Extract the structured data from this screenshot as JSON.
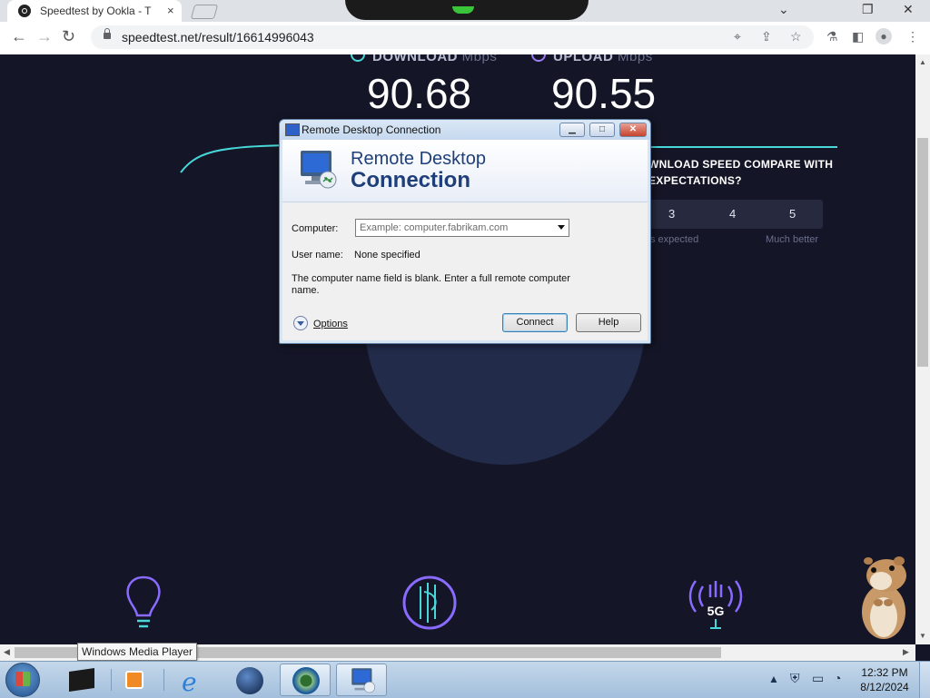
{
  "browser": {
    "tab_title": "Speedtest by Ookla - T",
    "tab_close": "×",
    "url": "speedtest.net/result/16614996043",
    "window_controls": {
      "minimize": "⌄",
      "restore": "❐",
      "close": "✕"
    },
    "nav": {
      "back": "←",
      "forward": "→",
      "reload": "↻"
    },
    "toolbar_icons": [
      "location-icon",
      "share-icon",
      "star-icon",
      "extension-icon",
      "sidepanel-icon",
      "profile-icon",
      "menu-icon"
    ]
  },
  "speedtest": {
    "download": {
      "label": "DOWNLOAD",
      "unit": "Mbps",
      "value": "90.68"
    },
    "upload": {
      "label": "UPLOAD",
      "unit": "Mbps",
      "value": "90.55"
    },
    "compare_text": "WNLOAD SPEED COMPARE WITH EXPECTATIONS?",
    "ratings": [
      "3",
      "4",
      "5"
    ],
    "rating_labels": {
      "mid": "s expected",
      "high": "Much better"
    },
    "colors": {
      "download": "#47d7d9",
      "upload": "#9e7cf6",
      "background": "#141526"
    }
  },
  "dialog": {
    "window_title": "Remote Desktop Connection",
    "heading_line1": "Remote Desktop",
    "heading_line2": "Connection",
    "computer_label": "Computer:",
    "computer_placeholder": "Example: computer.fabrikam.com",
    "username_label": "User name:",
    "username_value": "None specified",
    "message": "The computer name field is blank. Enter a full remote computer name.",
    "options_label": "Options",
    "connect_label": "Connect",
    "help_label": "Help",
    "title_buttons": {
      "minimize": "▁",
      "maximize": "□",
      "close": "✕"
    }
  },
  "tooltip": "Windows Media Player",
  "taskbar": {
    "time": "12:32 PM",
    "date": "8/12/2024",
    "pinned": [
      "app-icon",
      "media-player-icon",
      "internet-explorer-icon",
      "globe-icon",
      "browser-icon",
      "remote-desktop-icon"
    ],
    "tray": [
      "show-hidden-icon",
      "shield-icon",
      "display-icon",
      "network-icon"
    ]
  }
}
